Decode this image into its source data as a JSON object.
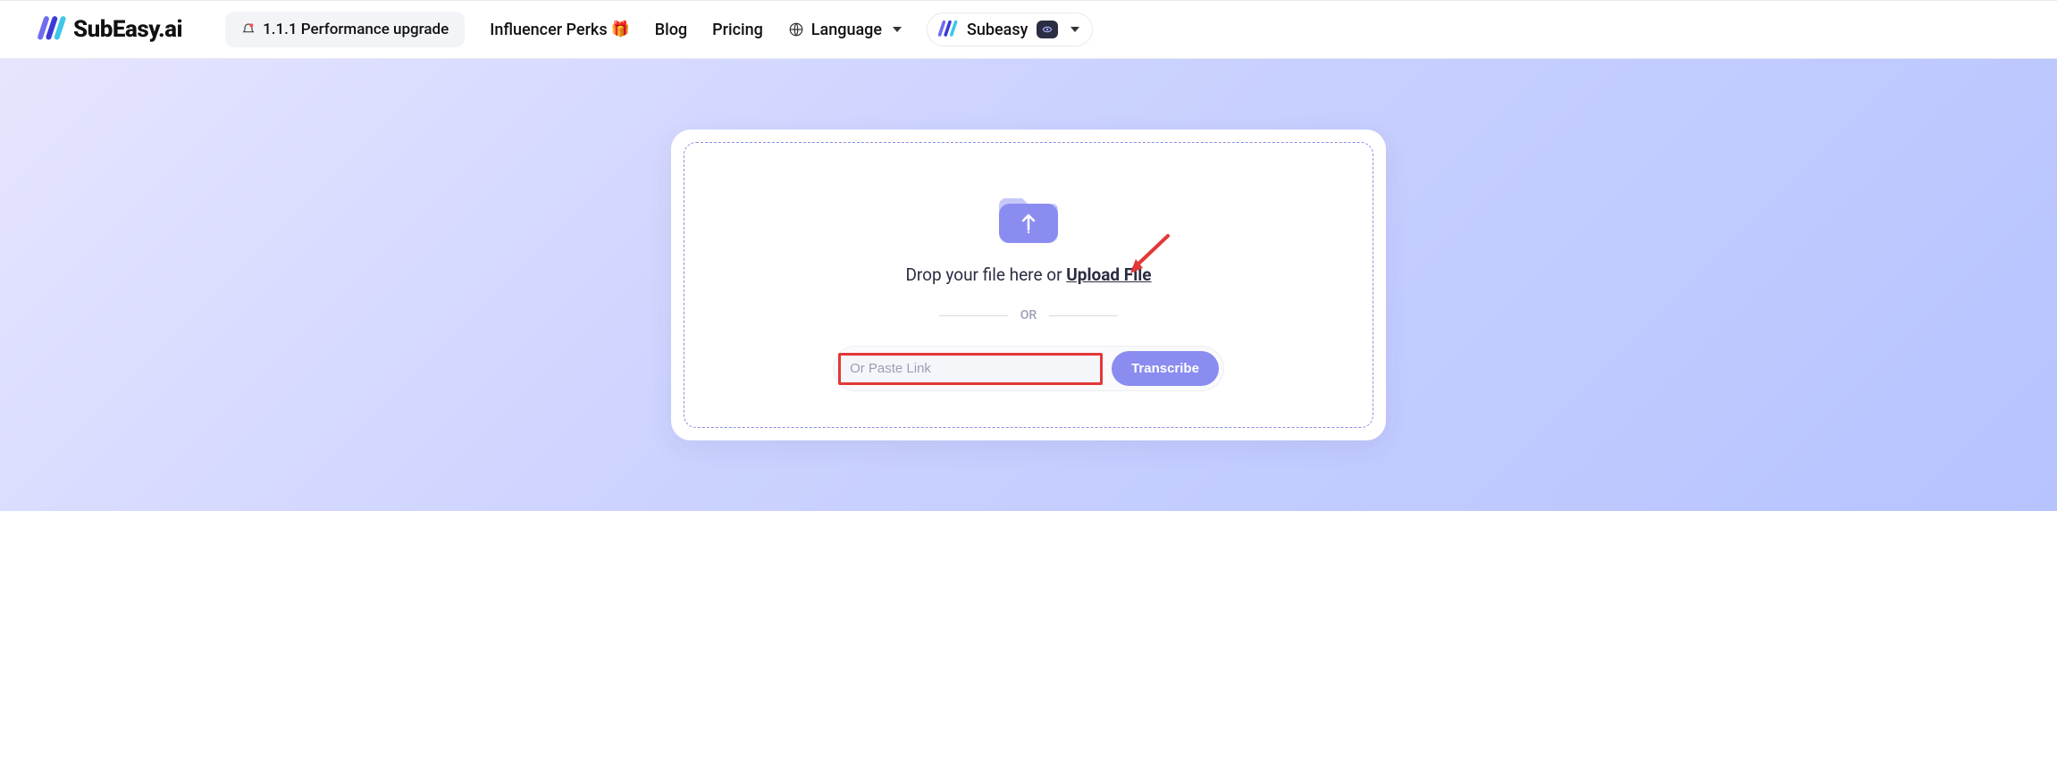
{
  "brand": {
    "name": "SubEasy.ai"
  },
  "nav": {
    "upgrade": "1.1.1 Performance upgrade",
    "influencer": "Influencer Perks",
    "blog": "Blog",
    "pricing": "Pricing",
    "language": "Language"
  },
  "user": {
    "name": "Subeasy"
  },
  "upload": {
    "drop_prefix": "Drop your file here or ",
    "upload_link": "Upload File",
    "or": "OR",
    "placeholder": "Or Paste Link",
    "transcribe": "Transcribe"
  }
}
